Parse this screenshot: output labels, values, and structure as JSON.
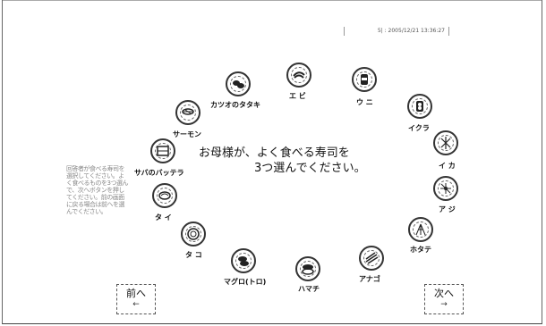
{
  "header": {
    "info_text": "5|  :  2005/12/21 13:36:27"
  },
  "question": {
    "line1": "お母様が、よく食べる寿司を",
    "line2": "3つ選んでください。"
  },
  "instructions": {
    "text": "回答者が食べる寿司を選択してください。よく食べるものを3つ選んで、次へボタンを押してください。前の画面に戻る場合は前へを選んでください。"
  },
  "sushi": [
    {
      "id": "ebi",
      "label": "エ ビ",
      "icon": "sushi-plate-icon"
    },
    {
      "id": "uni",
      "label": "ウ ニ",
      "icon": "sushi-plate-icon"
    },
    {
      "id": "ikura",
      "label": "イクラ",
      "icon": "sushi-plate-icon"
    },
    {
      "id": "ika",
      "label": "イ カ",
      "icon": "sushi-plate-icon"
    },
    {
      "id": "aji",
      "label": "ア ジ",
      "icon": "sushi-plate-icon"
    },
    {
      "id": "hotate",
      "label": "ホタテ",
      "icon": "sushi-plate-icon"
    },
    {
      "id": "anago",
      "label": "アナゴ",
      "icon": "sushi-plate-icon"
    },
    {
      "id": "hamachi",
      "label": "ハマチ",
      "icon": "sushi-plate-icon"
    },
    {
      "id": "maguro",
      "label": "マグロ(トロ)",
      "icon": "sushi-plate-icon"
    },
    {
      "id": "tako",
      "label": "タ コ",
      "icon": "sushi-plate-icon"
    },
    {
      "id": "tai",
      "label": "タ イ",
      "icon": "sushi-plate-icon"
    },
    {
      "id": "saba",
      "label": "サバのバッテラ",
      "icon": "sushi-plate-icon"
    },
    {
      "id": "salmon",
      "label": "サーモン",
      "icon": "sushi-plate-icon"
    },
    {
      "id": "katsuo",
      "label": "カツオのタタキ",
      "icon": "sushi-plate-icon"
    }
  ],
  "nav": {
    "prev_label": "前へ",
    "prev_arrow": "←",
    "next_label": "次へ",
    "next_arrow": "→"
  }
}
